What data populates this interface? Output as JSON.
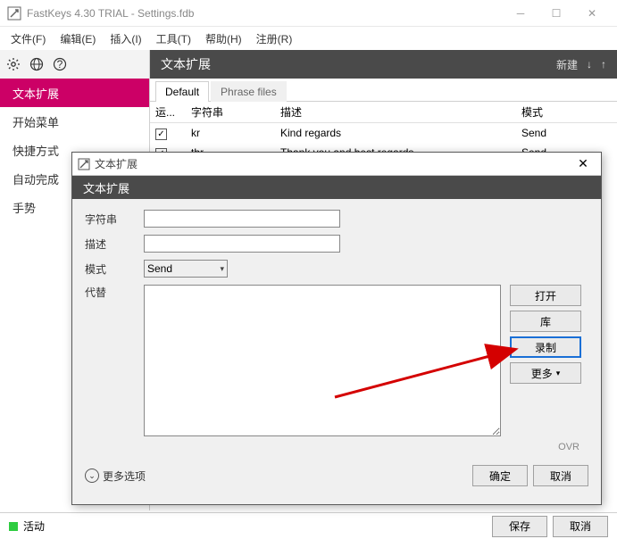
{
  "window": {
    "title": "FastKeys 4.30 TRIAL - Settings.fdb"
  },
  "menubar": {
    "items": [
      "文件(F)",
      "编辑(E)",
      "插入(I)",
      "工具(T)",
      "帮助(H)",
      "注册(R)"
    ]
  },
  "section": {
    "title": "文本扩展",
    "new": "新建"
  },
  "sidebar": {
    "items": [
      "文本扩展",
      "开始菜单",
      "快捷方式",
      "自动完成",
      "手势"
    ]
  },
  "tabs": {
    "items": [
      "Default",
      "Phrase files"
    ]
  },
  "listhead": {
    "run": "运...",
    "str": "字符串",
    "desc": "描述",
    "mode": "模式"
  },
  "rows": [
    {
      "checked": true,
      "str": "kr",
      "desc": "Kind regards",
      "mode": "Send"
    },
    {
      "checked": true,
      "str": "tbr",
      "desc": "Thank you and best regards",
      "mode": "Send"
    }
  ],
  "statusbar": {
    "active": "活动",
    "save": "保存",
    "cancel": "取消"
  },
  "dialog": {
    "title": "文本扩展",
    "header": "文本扩展",
    "labels": {
      "string": "字符串",
      "desc": "描述",
      "mode": "模式",
      "replace": "代替"
    },
    "mode_value": "Send",
    "side": {
      "open": "打开",
      "lib": "库",
      "record": "录制",
      "more": "更多"
    },
    "ovr": "OVR",
    "more_options": "更多选项",
    "ok": "确定",
    "cancel": "取消"
  }
}
